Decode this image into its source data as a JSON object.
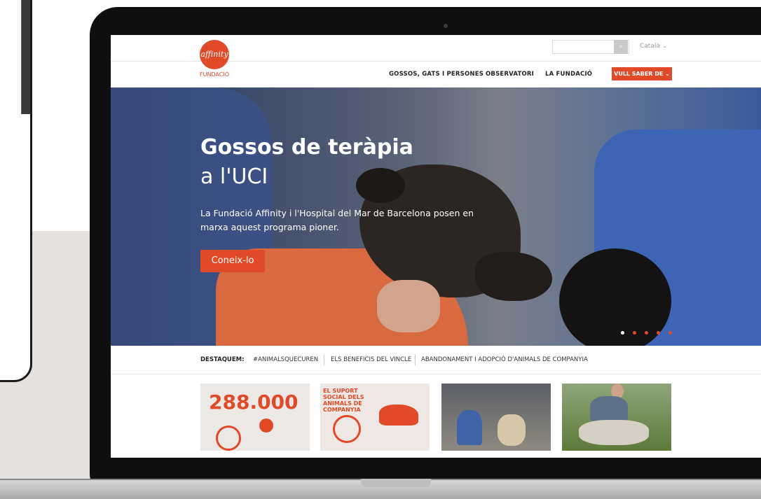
{
  "header": {
    "logo_brand": "affinity",
    "logo_subtitle": "FUNDACIÓ",
    "search_placeholder": "",
    "language": "Català",
    "nav": [
      "GOSSOS, GATS I PERSONES",
      "OBSERVATORI",
      "LA FUNDACIÓ"
    ],
    "cta": "VULL SABER DE"
  },
  "hero": {
    "title_line1": "Gossos de teràpia",
    "title_line2": "a l'UCI",
    "description": "La Fundació Affinity i l'Hospital del Mar de Barcelona posen en marxa aquest programa pioner.",
    "button": "Coneix-lo",
    "slides_total": 5,
    "active_slide": 1
  },
  "highlights": {
    "label": "DESTAQUEM:",
    "links": [
      "#ANIMALSQUECUREN",
      "ELS BENEFICIS DEL VINCLE",
      "ABANDONAMENT I ADOPCIÓ D'ANIMALS DE COMPANYIA"
    ]
  },
  "cards": {
    "card1_number": "288.000",
    "card2_title": "EL SUPORT SOCIAL DELS ANIMALS DE COMPANYIA"
  },
  "colors": {
    "brand": "#e04a28"
  }
}
